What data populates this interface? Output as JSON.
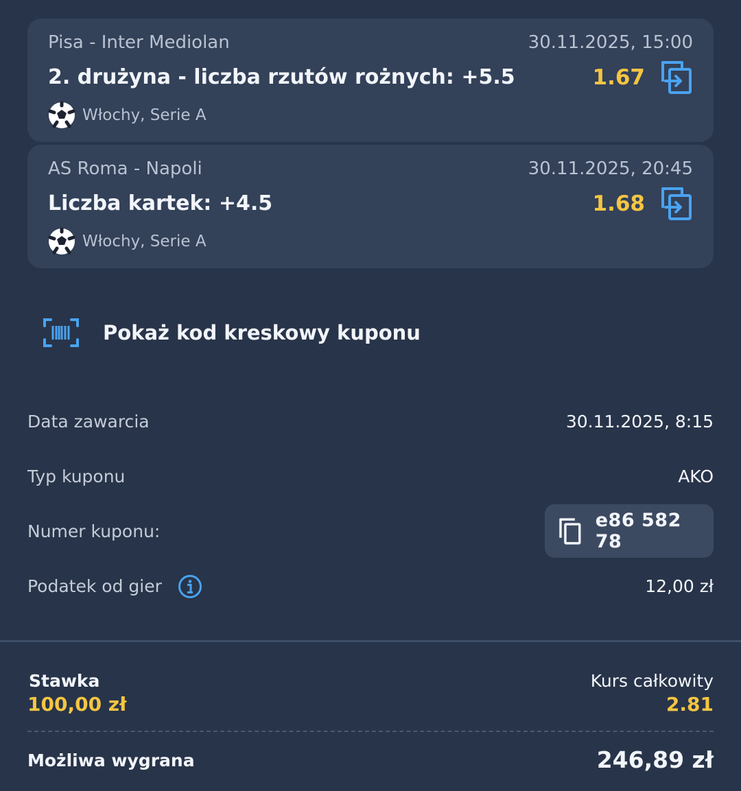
{
  "bets": [
    {
      "match": "Pisa - Inter Mediolan",
      "datetime": "30.11.2025, 15:00",
      "market": "2. drużyna - liczba rzutów rożnych: +5.5",
      "odds": "1.67",
      "league": "Włochy, Serie A",
      "sport_icon": "soccer-ball-icon",
      "action_icon": "copy-to-betslip-icon"
    },
    {
      "match": "AS Roma - Napoli",
      "datetime": "30.11.2025, 20:45",
      "market": "Liczba kartek: +4.5",
      "odds": "1.68",
      "league": "Włochy, Serie A",
      "sport_icon": "soccer-ball-icon",
      "action_icon": "copy-to-betslip-icon"
    }
  ],
  "barcode": {
    "label": "Pokaż kod kreskowy kuponu",
    "icon": "barcode-icon"
  },
  "details": {
    "date_label": "Data zawarcia",
    "date_value": "30.11.2025, 8:15",
    "type_label": "Typ kuponu",
    "type_value": "AKO",
    "number_label": "Numer kuponu:",
    "number_value": "e86 582 78",
    "tax_label": "Podatek od gier",
    "tax_value": "12,00 zł"
  },
  "summary": {
    "stake_label": "Stawka",
    "stake_value": "100,00 zł",
    "total_odds_label": "Kurs całkowity",
    "total_odds_value": "2.81",
    "possible_win_label": "Możliwa wygrana",
    "possible_win_value": "246,89 zł"
  },
  "colors": {
    "background": "#283449",
    "card": "#334159",
    "accent_yellow": "#f5c542",
    "accent_blue": "#4aa3f0"
  }
}
